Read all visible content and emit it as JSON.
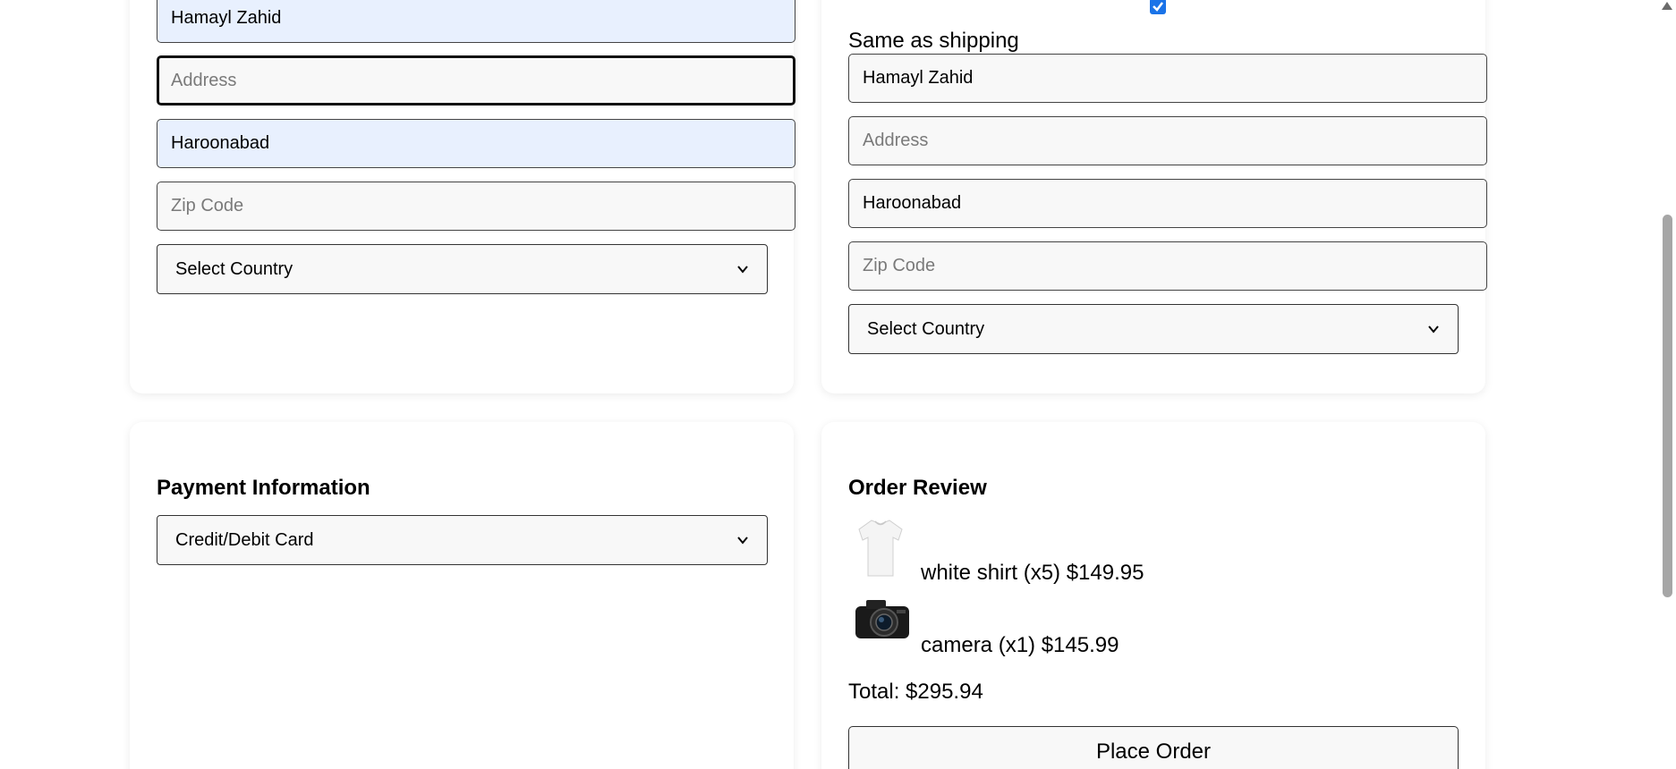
{
  "shipping": {
    "name_value": "Hamayl Zahid",
    "address_placeholder": "Address",
    "city_value": "Haroonabad",
    "zip_placeholder": "Zip Code",
    "country_selected": "Select Country"
  },
  "billing": {
    "same_as_shipping_label": "Same as shipping",
    "same_as_shipping_checked": true,
    "name_value": "Hamayl Zahid",
    "address_placeholder": "Address",
    "city_value": "Haroonabad",
    "zip_placeholder": "Zip Code",
    "country_selected": "Select Country"
  },
  "payment": {
    "title": "Payment Information",
    "method_selected": "Credit/Debit Card"
  },
  "review": {
    "title": "Order Review",
    "items": [
      {
        "icon": "white-shirt-image",
        "text": "white shirt (x5) $149.95"
      },
      {
        "icon": "camera-image",
        "text": "camera (x1) $145.99"
      }
    ],
    "total": "Total: $295.94",
    "place_order_label": "Place Order"
  },
  "colors": {
    "autofill_bg": "#e8f0fe",
    "checkbox_blue": "#1a73e8"
  }
}
